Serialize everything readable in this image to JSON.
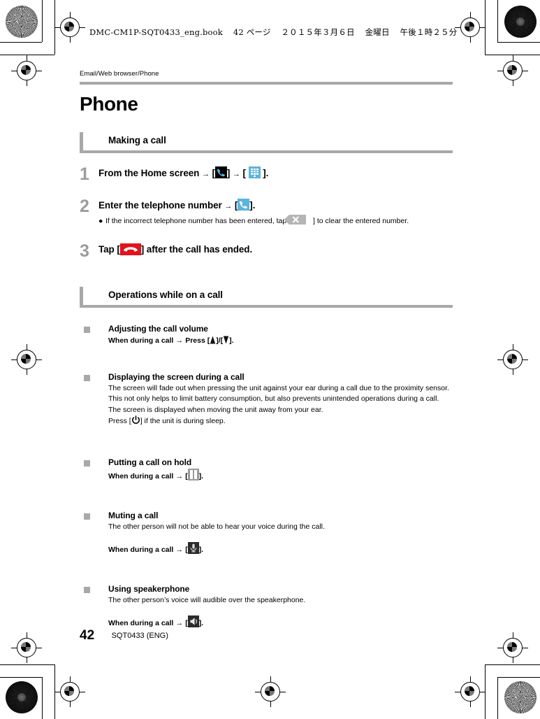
{
  "print_header": {
    "filename": "DMC-CM1P-SQT0433_eng.book",
    "page_label": "42 ページ",
    "date": "２０１５年３月６日",
    "weekday": "金曜日",
    "time": "午後１時２５分"
  },
  "breadcrumb": "Email/Web browser/Phone",
  "page_title": "Phone",
  "sections": [
    {
      "id": "making-a-call",
      "title": "Making a call",
      "steps": [
        {
          "number": "1",
          "title_parts": [
            "From the Home screen",
            "→",
            "[",
            "]",
            "→",
            "[",
            "].",
            ""
          ],
          "title_pre": "From the Home screen",
          "arrow1": "→",
          "br1": "[",
          "br2": "]",
          "arrow2": "→",
          "br3": "[",
          "br4": "].",
          "icons": [
            "phone-black-icon",
            "dialpad-icon"
          ],
          "sub": null
        },
        {
          "number": "2",
          "title_pre": "Enter the telephone number",
          "arrow1": "→",
          "br1": "[",
          "br2": "].",
          "icons": [
            "phone-blue-icon"
          ],
          "sub_bullet": "●",
          "sub_pre": "If the incorrect telephone number has been entered, tap [",
          "sub_post": "] to clear the entered number.",
          "sub_icon": "backspace-icon"
        },
        {
          "number": "3",
          "title_pre": "Tap [",
          "title_post": "] after the call has ended.",
          "icons": [
            "end-call-icon"
          ]
        }
      ]
    },
    {
      "id": "operations-while-on-a-call",
      "title": "Operations while on a call",
      "topics": [
        {
          "id": "adjusting-the-call-volume",
          "title": "Adjusting the call volume",
          "line_pre": "When during a call",
          "arrow": "→",
          "line_mid": "Press [",
          "sep": "]/[",
          "line_post": "].",
          "icons": [
            "volume-up-icon",
            "volume-down-icon"
          ]
        },
        {
          "id": "displaying-the-screen-during-a-call",
          "title": "Displaying the screen during a call",
          "paragraphs": [
            "The screen will fade out when pressing the unit against your ear during a call due to the proximity sensor. This not only helps to limit battery consumption, but also prevents unintended operations during a call.",
            "The screen is displayed when moving the unit away from your ear."
          ],
          "press_pre": "Press [",
          "press_post": "] if the unit is during sleep.",
          "press_icon": "power-icon"
        },
        {
          "id": "putting-a-call-on-hold",
          "title": "Putting a call on hold",
          "line_pre": "When during a call",
          "arrow": "→",
          "line_mid": "[",
          "line_post": "].",
          "icons": [
            "hold-icon"
          ]
        },
        {
          "id": "muting-a-call",
          "title": "Muting a call",
          "paragraph": "The other person will not be able to hear your voice during the call.",
          "line_pre": "When during a call",
          "arrow": "→",
          "line_mid": "[",
          "line_post": "].",
          "icons": [
            "mute-icon"
          ]
        },
        {
          "id": "using-speakerphone",
          "title": "Using speakerphone",
          "paragraph": "The other person’s voice will audible over the speakerphone.",
          "line_pre": "When during a call",
          "arrow": "→",
          "line_mid": "[",
          "line_post": "].",
          "icons": [
            "speaker-icon"
          ]
        }
      ]
    }
  ],
  "footer": {
    "page_number": "42",
    "doc_code": "SQT0433 (ENG)"
  },
  "colors": {
    "rule_gray": "#a8a8a8",
    "step_number_gray": "#9c9c9c",
    "icon_blue": "#5bb4de",
    "icon_red": "#e3121b",
    "icon_dark": "#2b2b2b"
  }
}
